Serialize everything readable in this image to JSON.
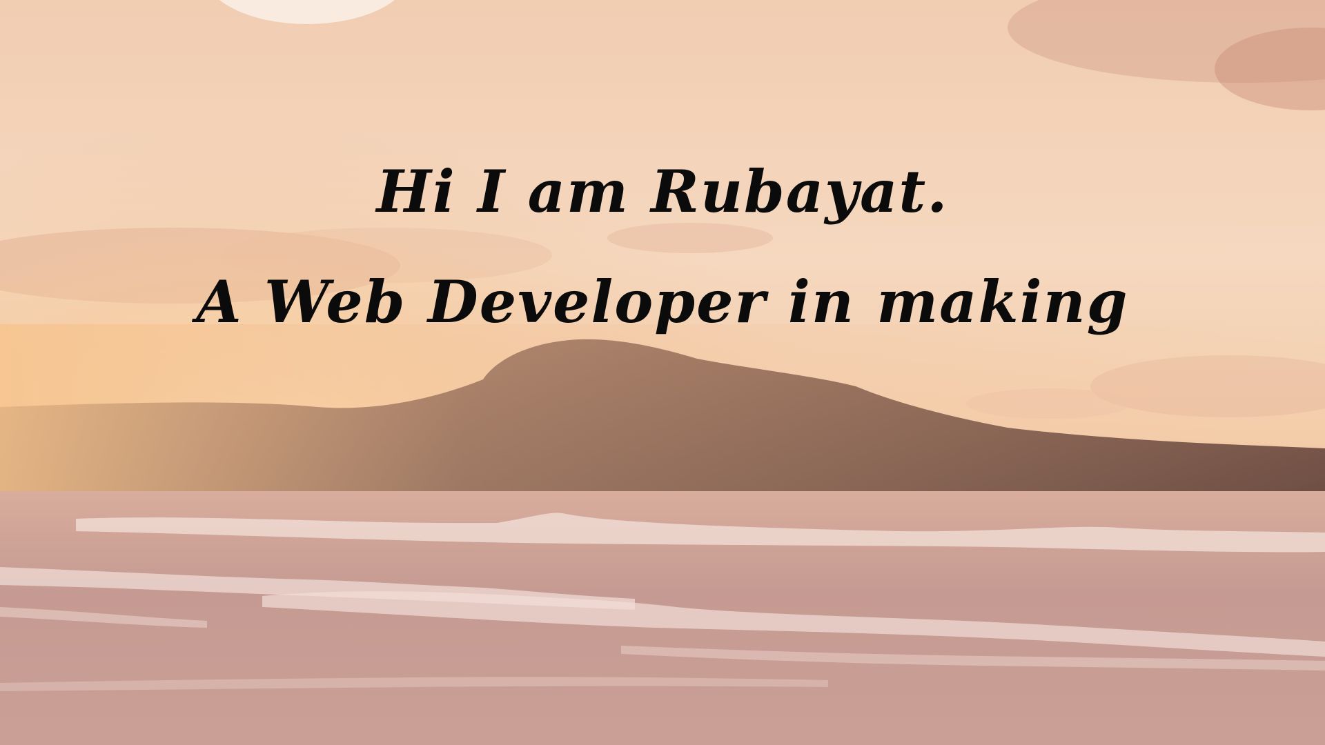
{
  "hero": {
    "line1": "Hi I am Rubayat.",
    "line2": "A Web Developer in making"
  },
  "colors": {
    "sky_top": "#f3d2b6",
    "sky_mid": "#f6d7bc",
    "horizon_glow": "#f7c89a",
    "mountain": "#7d5a4a",
    "sea": "#c99a8f",
    "foam": "#f3e1dc",
    "text": "#0b0b0b"
  }
}
